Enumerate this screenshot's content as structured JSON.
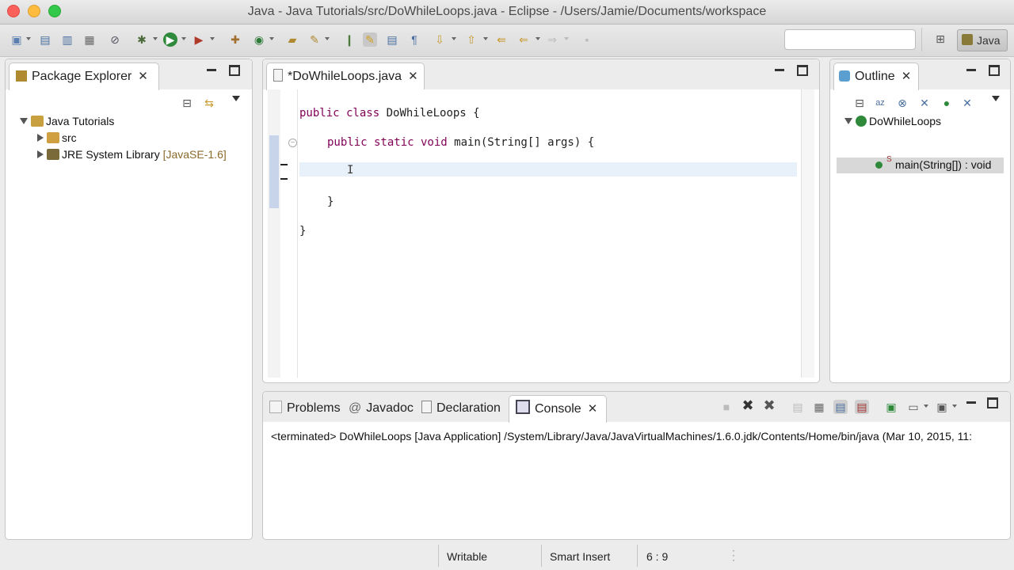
{
  "window": {
    "title": "Java - Java Tutorials/src/DoWhileLoops.java - Eclipse - /Users/Jamie/Documents/workspace"
  },
  "toolbar": {
    "search_value": "",
    "perspective_label": "Java",
    "icons": [
      "new-icon",
      "save-icon",
      "save-all-icon",
      "print-icon",
      "skip-breakpoints-icon",
      "debug-icon",
      "run-icon",
      "coverage-icon",
      "external-tools-icon",
      "new-java-project-icon",
      "new-class-icon",
      "open-type-icon",
      "search-icon",
      "toggle-mark-occurrences-icon",
      "highlight-icon",
      "block-selection-icon",
      "show-whitespace-icon",
      "next-annotation-icon",
      "previous-annotation-icon",
      "last-edit-icon",
      "back-icon",
      "forward-icon",
      "pin-editor-icon"
    ]
  },
  "package_explorer": {
    "tab_label": "Package Explorer",
    "project": "Java Tutorials",
    "items": [
      {
        "label": "src",
        "decoration": ""
      },
      {
        "label": "JRE System Library",
        "decoration": "[JavaSE-1.6]"
      }
    ]
  },
  "editor": {
    "tab_label": "*DoWhileLoops.java",
    "lines": [
      {
        "kw": "public class",
        "rest": " DoWhileLoops {"
      },
      {
        "kw": "public static void",
        "rest": " main(String[] args) {"
      },
      {
        "kw": "",
        "rest": ""
      },
      {
        "kw": "",
        "rest": "}"
      },
      {
        "kw": "",
        "rest": "}"
      }
    ]
  },
  "outline": {
    "tab_label": "Outline",
    "class_name": "DoWhileLoops",
    "method": "main(String[]) : void",
    "method_modifier": "S"
  },
  "bottom_panel": {
    "tabs": [
      {
        "label": "Problems",
        "icon": "problems-icon"
      },
      {
        "label": "Javadoc",
        "icon": "at-icon"
      },
      {
        "label": "Declaration",
        "icon": "declaration-icon"
      },
      {
        "label": "Console",
        "icon": "console-icon"
      }
    ],
    "console_text": "<terminated> DoWhileLoops [Java Application] /System/Library/Java/JavaVirtualMachines/1.6.0.jdk/Contents/Home/bin/java (Mar 10, 2015, 11:"
  },
  "statusbar": {
    "writable": "Writable",
    "insert_mode": "Smart Insert",
    "position": "6 : 9"
  }
}
